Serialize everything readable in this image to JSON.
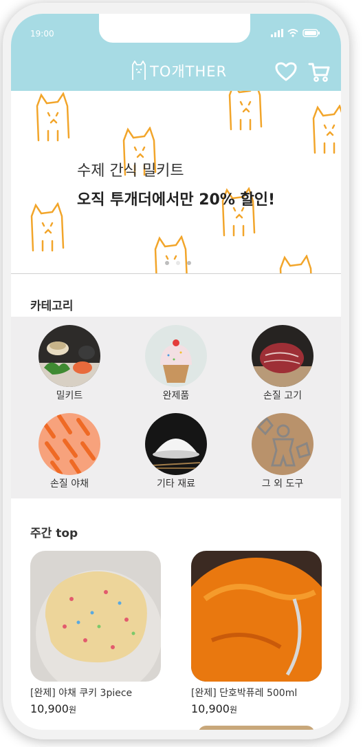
{
  "status": {
    "time": "19:00"
  },
  "header": {
    "logo_text": "TO개THER",
    "icons": [
      "heart-icon",
      "cart-icon"
    ],
    "background": "#a7dbe4"
  },
  "banner": {
    "subtitle": "수제 간식 밀키트",
    "title": "오직 투개더에서만 20% 할인!",
    "slide_count": 3,
    "active_slide": 2
  },
  "categories": {
    "title": "카테고리",
    "items": [
      {
        "label": "밀키트"
      },
      {
        "label": "완제품"
      },
      {
        "label": "손질 고기"
      },
      {
        "label": "손질 야채"
      },
      {
        "label": "기타 재료"
      },
      {
        "label": "그 외 도구"
      }
    ]
  },
  "weekly": {
    "title": "주간 top",
    "items": [
      {
        "name": "[완제] 야채 쿠키 3piece",
        "price": "10,900",
        "unit": "원"
      },
      {
        "name": "[완제] 단호박퓨레 500ml",
        "price": "10,900",
        "unit": "원"
      }
    ]
  }
}
